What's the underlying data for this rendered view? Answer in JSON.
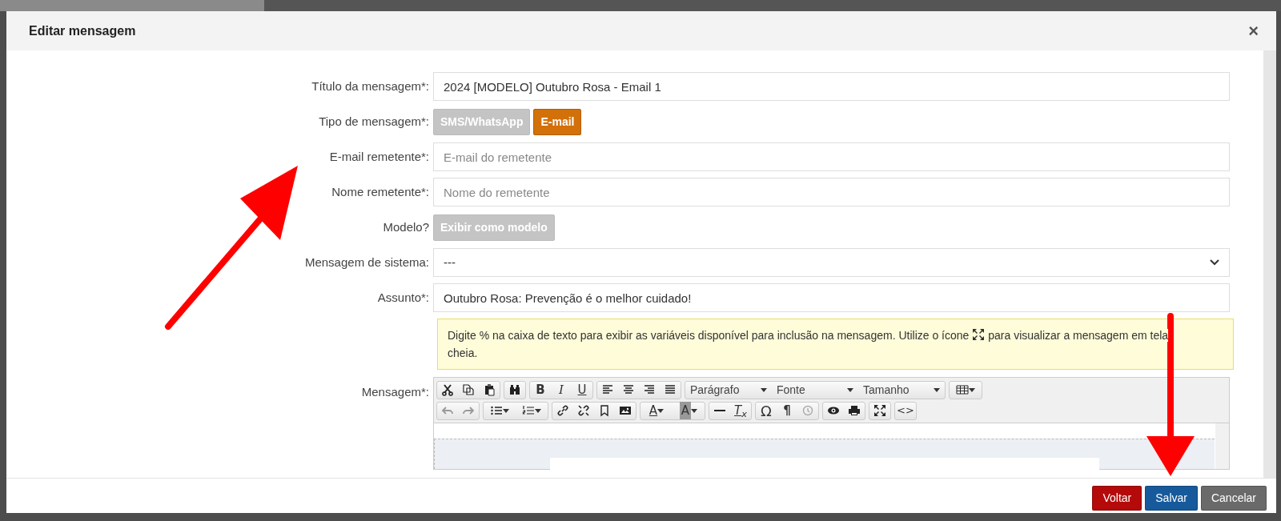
{
  "modal": {
    "title": "Editar mensagem",
    "close": "×"
  },
  "form": {
    "title_field": {
      "label": "Título da mensagem*:",
      "value": "2024 [MODELO] Outubro Rosa - Email 1"
    },
    "type": {
      "label": "Tipo de mensagem*:",
      "options": [
        {
          "label": "SMS/WhatsApp",
          "selected": false
        },
        {
          "label": "E-mail",
          "selected": true
        }
      ]
    },
    "sender_email": {
      "label": "E-mail remetente*:",
      "placeholder": "E-mail do remetente"
    },
    "sender_name": {
      "label": "Nome remetente*:",
      "placeholder": "Nome do remetente"
    },
    "template": {
      "label": "Modelo?",
      "button": "Exibir como modelo",
      "on": false
    },
    "system_message": {
      "label": "Mensagem de sistema:",
      "value": "---"
    },
    "subject": {
      "label": "Assunto*:",
      "value": "Outubro Rosa: Prevenção é o melhor cuidado!"
    },
    "hint": {
      "before": "Digite % na caixa de texto para exibir as variáveis disponível para inclusão na mensagem. Utilize o ícone",
      "after_lines": [
        "para visualizar a mensagem em tela",
        "cheia."
      ]
    },
    "message": {
      "label": "Mensagem*:",
      "toolbar": {
        "bold": "B",
        "italic": "I",
        "underline": "U",
        "format": "Parágrafo",
        "font": "Fonte",
        "size": "Tamanho",
        "text_color": "A",
        "bg_color": "A",
        "clear_format": "T$_{x}$",
        "omega": "Ω",
        "pilcrow": "¶",
        "source": "<>"
      }
    }
  },
  "footer": {
    "buttons": [
      {
        "label": "Voltar",
        "kind": "danger"
      },
      {
        "label": "Salvar",
        "kind": "primary"
      },
      {
        "label": "Cancelar",
        "kind": "secondary"
      }
    ]
  }
}
